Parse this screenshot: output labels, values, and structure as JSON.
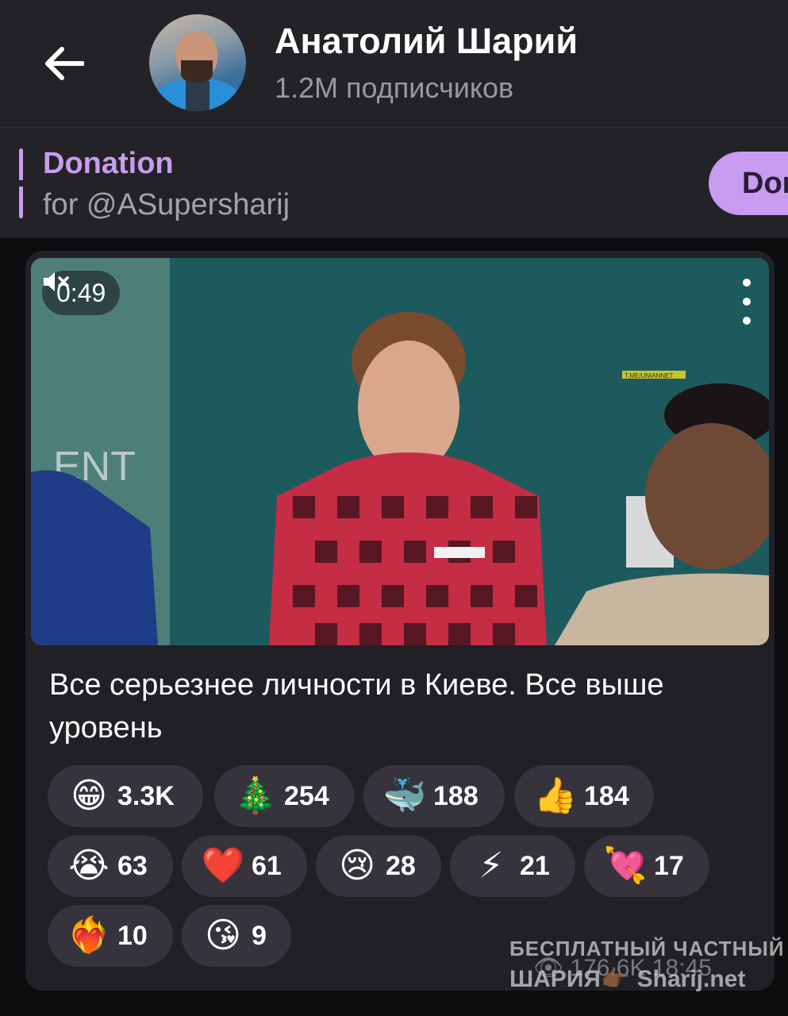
{
  "header": {
    "back_icon": "arrow-left-icon",
    "channel_name": "Анатолий Шарий",
    "subscribers": "1.2M подписчиков"
  },
  "pinned": {
    "title": "Donation",
    "subtitle": "for @ASupersharij",
    "button_label": "Don"
  },
  "message": {
    "video": {
      "duration": "0:49",
      "mute_icon": "speaker-muted-icon",
      "menu_icon": "more-vertical-icon",
      "watermark": "T.ME/UNIANNET",
      "wall_text": "ENT"
    },
    "caption": "Все серьезнее личности в Киеве. Все выше уровень",
    "reactions": [
      {
        "emoji": "😁",
        "count": "3.3K"
      },
      {
        "emoji": "🎄",
        "count": "254"
      },
      {
        "emoji": "🐳",
        "count": "188"
      },
      {
        "emoji": "👍",
        "count": "184"
      },
      {
        "emoji": "😭",
        "count": "63"
      },
      {
        "emoji": "❤️",
        "count": "61"
      },
      {
        "emoji": "😢",
        "count": "28"
      },
      {
        "emoji": "⚡",
        "count": "21"
      },
      {
        "emoji": "💘",
        "count": "17"
      },
      {
        "emoji": "❤️‍🔥",
        "count": "10"
      },
      {
        "emoji": "😘",
        "count": "9"
      }
    ],
    "views": "176.6K",
    "time": "18:45"
  },
  "watermark": {
    "line1": "БЕСПЛАТНЫЙ ЧАСТНЫЙ",
    "line2": "ШАРИЯ👉🏾 Sharij.net"
  },
  "colors": {
    "accent": "#c89cf0",
    "header_bg": "#232226",
    "bubble_bg": "#212025",
    "reaction_bg": "#37333d"
  }
}
